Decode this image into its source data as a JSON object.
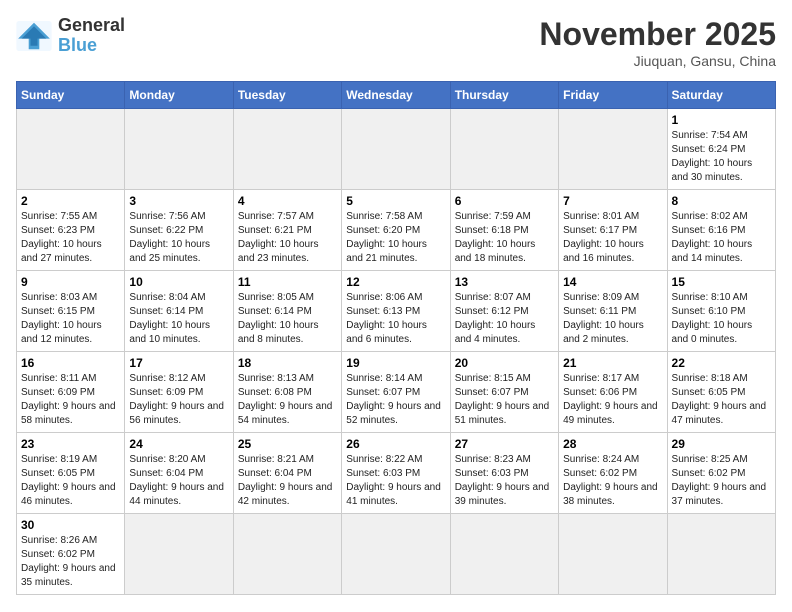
{
  "header": {
    "logo_general": "General",
    "logo_blue": "Blue",
    "month_title": "November 2025",
    "location": "Jiuquan, Gansu, China"
  },
  "days_of_week": [
    "Sunday",
    "Monday",
    "Tuesday",
    "Wednesday",
    "Thursday",
    "Friday",
    "Saturday"
  ],
  "weeks": [
    [
      {
        "day": "",
        "empty": true
      },
      {
        "day": "",
        "empty": true
      },
      {
        "day": "",
        "empty": true
      },
      {
        "day": "",
        "empty": true
      },
      {
        "day": "",
        "empty": true
      },
      {
        "day": "",
        "empty": true
      },
      {
        "day": "1",
        "sunrise": "7:54 AM",
        "sunset": "6:24 PM",
        "daylight": "10 hours and 30 minutes."
      }
    ],
    [
      {
        "day": "2",
        "sunrise": "7:55 AM",
        "sunset": "6:23 PM",
        "daylight": "10 hours and 27 minutes."
      },
      {
        "day": "3",
        "sunrise": "7:56 AM",
        "sunset": "6:22 PM",
        "daylight": "10 hours and 25 minutes."
      },
      {
        "day": "4",
        "sunrise": "7:57 AM",
        "sunset": "6:21 PM",
        "daylight": "10 hours and 23 minutes."
      },
      {
        "day": "5",
        "sunrise": "7:58 AM",
        "sunset": "6:20 PM",
        "daylight": "10 hours and 21 minutes."
      },
      {
        "day": "6",
        "sunrise": "7:59 AM",
        "sunset": "6:18 PM",
        "daylight": "10 hours and 18 minutes."
      },
      {
        "day": "7",
        "sunrise": "8:01 AM",
        "sunset": "6:17 PM",
        "daylight": "10 hours and 16 minutes."
      },
      {
        "day": "8",
        "sunrise": "8:02 AM",
        "sunset": "6:16 PM",
        "daylight": "10 hours and 14 minutes."
      }
    ],
    [
      {
        "day": "9",
        "sunrise": "8:03 AM",
        "sunset": "6:15 PM",
        "daylight": "10 hours and 12 minutes."
      },
      {
        "day": "10",
        "sunrise": "8:04 AM",
        "sunset": "6:14 PM",
        "daylight": "10 hours and 10 minutes."
      },
      {
        "day": "11",
        "sunrise": "8:05 AM",
        "sunset": "6:14 PM",
        "daylight": "10 hours and 8 minutes."
      },
      {
        "day": "12",
        "sunrise": "8:06 AM",
        "sunset": "6:13 PM",
        "daylight": "10 hours and 6 minutes."
      },
      {
        "day": "13",
        "sunrise": "8:07 AM",
        "sunset": "6:12 PM",
        "daylight": "10 hours and 4 minutes."
      },
      {
        "day": "14",
        "sunrise": "8:09 AM",
        "sunset": "6:11 PM",
        "daylight": "10 hours and 2 minutes."
      },
      {
        "day": "15",
        "sunrise": "8:10 AM",
        "sunset": "6:10 PM",
        "daylight": "10 hours and 0 minutes."
      }
    ],
    [
      {
        "day": "16",
        "sunrise": "8:11 AM",
        "sunset": "6:09 PM",
        "daylight": "9 hours and 58 minutes."
      },
      {
        "day": "17",
        "sunrise": "8:12 AM",
        "sunset": "6:09 PM",
        "daylight": "9 hours and 56 minutes."
      },
      {
        "day": "18",
        "sunrise": "8:13 AM",
        "sunset": "6:08 PM",
        "daylight": "9 hours and 54 minutes."
      },
      {
        "day": "19",
        "sunrise": "8:14 AM",
        "sunset": "6:07 PM",
        "daylight": "9 hours and 52 minutes."
      },
      {
        "day": "20",
        "sunrise": "8:15 AM",
        "sunset": "6:07 PM",
        "daylight": "9 hours and 51 minutes."
      },
      {
        "day": "21",
        "sunrise": "8:17 AM",
        "sunset": "6:06 PM",
        "daylight": "9 hours and 49 minutes."
      },
      {
        "day": "22",
        "sunrise": "8:18 AM",
        "sunset": "6:05 PM",
        "daylight": "9 hours and 47 minutes."
      }
    ],
    [
      {
        "day": "23",
        "sunrise": "8:19 AM",
        "sunset": "6:05 PM",
        "daylight": "9 hours and 46 minutes."
      },
      {
        "day": "24",
        "sunrise": "8:20 AM",
        "sunset": "6:04 PM",
        "daylight": "9 hours and 44 minutes."
      },
      {
        "day": "25",
        "sunrise": "8:21 AM",
        "sunset": "6:04 PM",
        "daylight": "9 hours and 42 minutes."
      },
      {
        "day": "26",
        "sunrise": "8:22 AM",
        "sunset": "6:03 PM",
        "daylight": "9 hours and 41 minutes."
      },
      {
        "day": "27",
        "sunrise": "8:23 AM",
        "sunset": "6:03 PM",
        "daylight": "9 hours and 39 minutes."
      },
      {
        "day": "28",
        "sunrise": "8:24 AM",
        "sunset": "6:02 PM",
        "daylight": "9 hours and 38 minutes."
      },
      {
        "day": "29",
        "sunrise": "8:25 AM",
        "sunset": "6:02 PM",
        "daylight": "9 hours and 37 minutes."
      }
    ],
    [
      {
        "day": "30",
        "sunrise": "8:26 AM",
        "sunset": "6:02 PM",
        "daylight": "9 hours and 35 minutes."
      },
      {
        "day": "",
        "empty": true
      },
      {
        "day": "",
        "empty": true
      },
      {
        "day": "",
        "empty": true
      },
      {
        "day": "",
        "empty": true
      },
      {
        "day": "",
        "empty": true
      },
      {
        "day": "",
        "empty": true
      }
    ]
  ]
}
